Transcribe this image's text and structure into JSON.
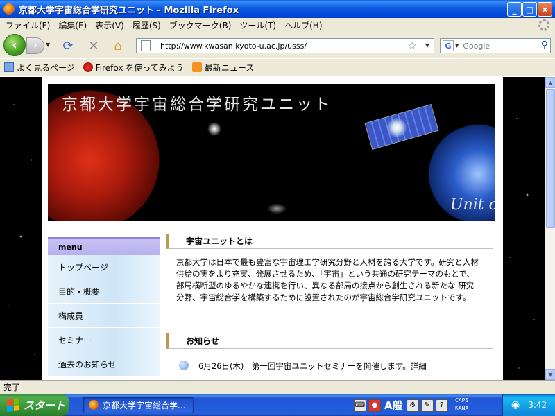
{
  "window": {
    "title": "京都大学宇宙総合学研究ユニット - Mozilla Firefox",
    "min_label": "_",
    "max_label": "□",
    "close_label": "×"
  },
  "menu": {
    "items": [
      "ファイル(F)",
      "編集(E)",
      "表示(V)",
      "履歴(S)",
      "ブックマーク(B)",
      "ツール(T)",
      "ヘルプ(H)"
    ]
  },
  "nav": {
    "url": "http://www.kwasan.kyoto-u.ac.jp/usss/",
    "search_placeholder": "Google",
    "search_engine_letter": "G"
  },
  "bookmarks": {
    "items": [
      "よく見るページ",
      "Firefox を使ってみよう",
      "最新ニュース"
    ]
  },
  "page": {
    "banner_title": "京都大学宇宙総合学研究ユニット",
    "banner_subtitle": "Unit o",
    "sidebar_head": "menu",
    "sidebar_items": [
      "トップページ",
      "目的・概要",
      "構成員",
      "セミナー",
      "過去のお知らせ"
    ],
    "about_heading": "宇宙ユニットとは",
    "about_text": "京都大学は日本で最も豊富な宇宙理工学研究分野と人材を誇る大学です。研究と人材供給の実をより充実、発展させるため、「宇宙」という共通の研究テーマのもとで、部局横断型のゆるやかな連携を行い、異なる部局の接点から創生される新たな 研究分野、宇宙総合学を構築するために設置されたのが宇宙総合学研究ユニットです。",
    "news_heading": "お知らせ",
    "news_first": "6月26日(木)　第一回宇宙ユニットセミナーを開催します。詳細"
  },
  "status": {
    "text": "完了"
  },
  "taskbar": {
    "start_label": "スタート",
    "task_label": "京都大学宇宙総合学...",
    "ime_mode": "A般",
    "caps": "CAPS",
    "kana": "KANA",
    "clock": "3:42"
  }
}
